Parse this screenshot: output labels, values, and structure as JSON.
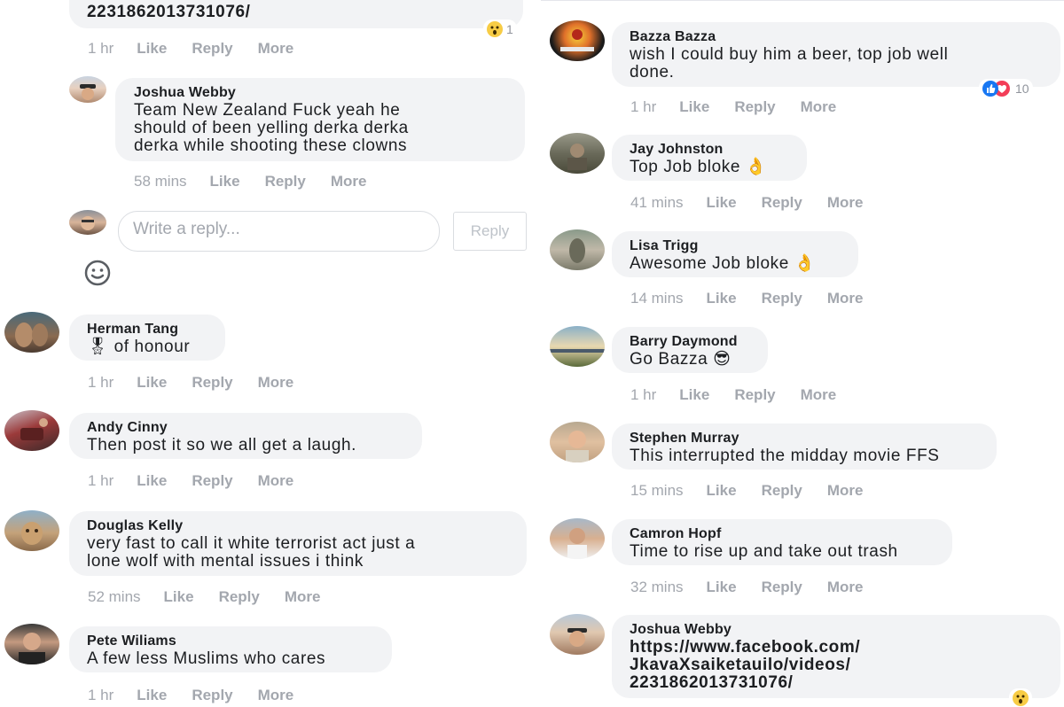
{
  "left": {
    "top_comment": {
      "text_fragment": "223186201373107​6/",
      "reaction_count": "1",
      "actions": {
        "time": "1 hr",
        "like": "Like",
        "reply": "Reply",
        "more": "More"
      }
    },
    "comments": [
      {
        "name": "Joshua Webby",
        "text": "Team New Zealand Fuck yeah he\nshould of been yelling derka derka\nderka while shooting these clowns",
        "time": "58 mins",
        "like": "Like",
        "reply": "Reply",
        "more": "More"
      },
      {
        "name": "Herman Tang",
        "text": "🎖 of honour",
        "time": "1 hr",
        "like": "Like",
        "reply": "Reply",
        "more": "More"
      },
      {
        "name": "Andy Cinny",
        "text": "Then post it so we all get a laugh.",
        "time": "1 hr",
        "like": "Like",
        "reply": "Reply",
        "more": "More"
      },
      {
        "name": "Douglas Kelly",
        "text": "very fast to call it white terrorist act just a\nlone wolf with mental issues i think",
        "time": "52 mins",
        "like": "Like",
        "reply": "Reply",
        "more": "More"
      },
      {
        "name": "Pete Wiliams",
        "text": "A few less Muslims who cares",
        "time": "1 hr",
        "like": "Like",
        "reply": "Reply",
        "more": "More"
      }
    ],
    "composer": {
      "placeholder": "Write a reply...",
      "button": "Reply"
    }
  },
  "right": {
    "comments": [
      {
        "name": "Bazza Bazza",
        "text": "wish I could buy him a beer, top job well\ndone.",
        "time": "1 hr",
        "like": "Like",
        "reply": "Reply",
        "more": "More",
        "reaction_count": "10"
      },
      {
        "name": "Jay Johnston",
        "text": "Top Job bloke 👌",
        "time": "41 mins",
        "like": "Like",
        "reply": "Reply",
        "more": "More"
      },
      {
        "name": "Lisa Trigg",
        "text": "Awesome Job bloke 👌",
        "time": "14 mins",
        "like": "Like",
        "reply": "Reply",
        "more": "More"
      },
      {
        "name": "Barry Daymond",
        "text": "Go Bazza 😎",
        "time": "1 hr",
        "like": "Like",
        "reply": "Reply",
        "more": "More"
      },
      {
        "name": "Stephen Murray",
        "text": "This interrupted the midday movie FFS",
        "time": "15 mins",
        "like": "Like",
        "reply": "Reply",
        "more": "More"
      },
      {
        "name": "Camron Hopf",
        "text": "Time to rise up and take out trash",
        "time": "32 mins",
        "like": "Like",
        "reply": "Reply",
        "more": "More"
      },
      {
        "name": "Joshua Webby",
        "text": "https://www.facebook.com/\nJkavaXsaiketauilo/videos/\n2231862013731076/",
        "reaction_count": ""
      }
    ]
  },
  "colors": {
    "bubble": "#f2f3f5",
    "meta": "#a3a7ae",
    "like_blue": "#1877f2",
    "love_red": "#f33e58",
    "wow_yellow": "#f7cc45"
  },
  "icons": [
    "wow-reaction-icon",
    "like-reaction-icon",
    "love-reaction-icon",
    "emoji-smiley-icon"
  ]
}
